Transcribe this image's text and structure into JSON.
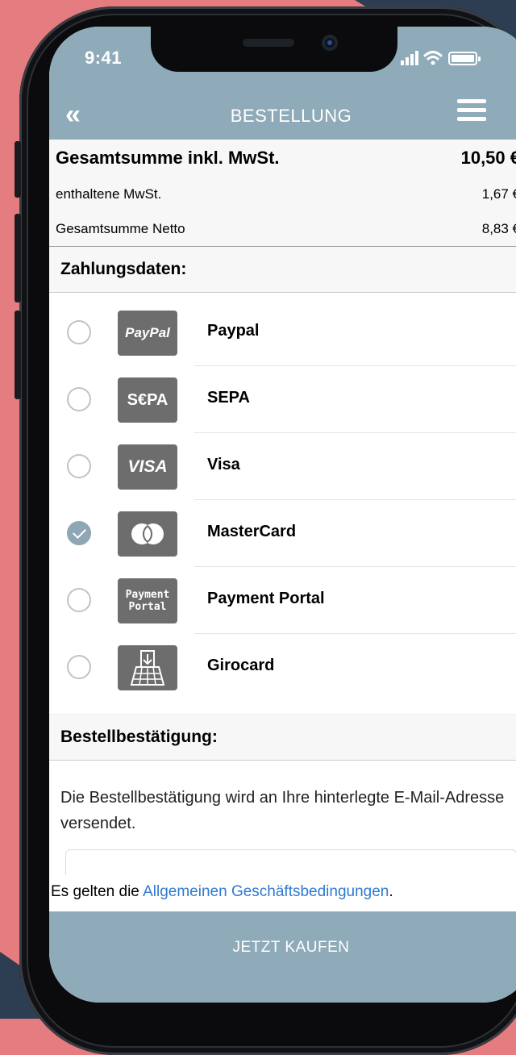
{
  "status_bar": {
    "time": "9:41"
  },
  "navbar": {
    "title": "BESTELLUNG"
  },
  "summary": {
    "total_label": "Gesamtsumme inkl. MwSt.",
    "total_value": "10,50 €",
    "vat_label": "enthaltene MwSt.",
    "vat_value": "1,67 €",
    "net_label": "Gesamtsumme Netto",
    "net_value": "8,83 €"
  },
  "payment": {
    "heading": "Zahlungsdaten:",
    "methods": [
      {
        "label": "Paypal",
        "logo_text": "PayPal",
        "selected": false
      },
      {
        "label": "SEPA",
        "logo_text": "S€PA",
        "selected": false
      },
      {
        "label": "Visa",
        "logo_text": "VISA",
        "selected": false
      },
      {
        "label": "MasterCard",
        "logo_text": "",
        "selected": true
      },
      {
        "label": "Payment Portal",
        "logo_text": "Payment Portal",
        "selected": false
      },
      {
        "label": "Girocard",
        "logo_text": "",
        "selected": false
      }
    ]
  },
  "confirmation": {
    "heading": "Bestellbestätigung:",
    "text": "Die Bestellbestätigung wird an Ihre hinterlegte E-Mail-Adresse versendet."
  },
  "terms": {
    "prefix": "Es gelten die ",
    "link": "Allgemeinen Geschäftsbedingungen",
    "suffix": "."
  },
  "buy_button": {
    "label": "JETZT KAUFEN"
  },
  "colors": {
    "accent": "#8fabb9",
    "background": "#e57c7f",
    "link": "#2f7ad1"
  }
}
